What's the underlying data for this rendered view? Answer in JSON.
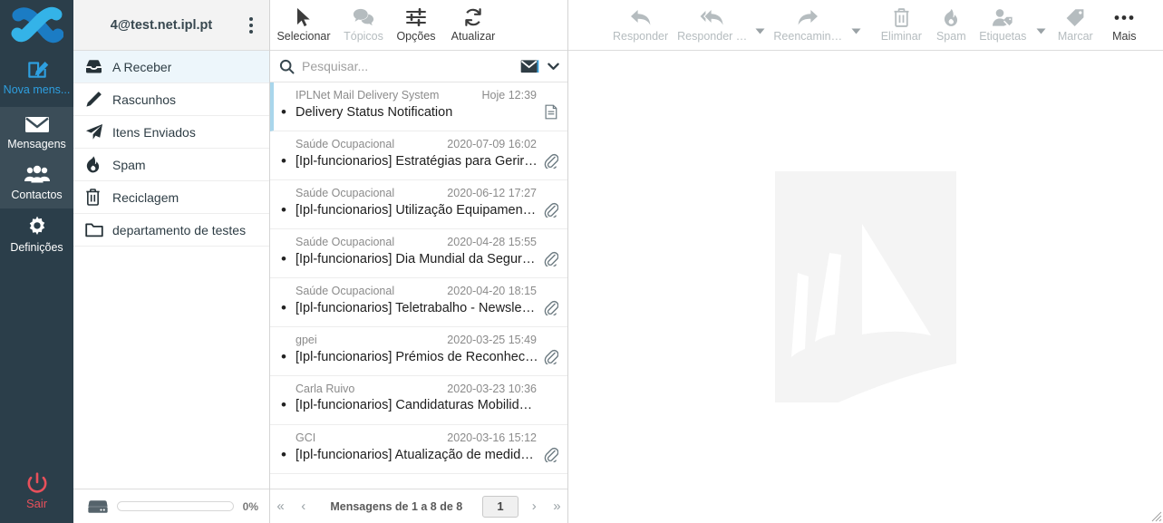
{
  "colors": {
    "rail_bg": "#2b3e4a",
    "rail_group_bg": "#3b4d58",
    "accent_blue": "#2e9fe0",
    "logout_red": "#e8505b",
    "selected_row": "#edf6fb",
    "header_bg": "#f3f3f3"
  },
  "rail": {
    "logo_name": "logo-icon",
    "items": [
      {
        "label": "Nova mens...",
        "icon": "compose-pencil-icon",
        "name": "rail-item-compose"
      },
      {
        "label": "Mensagens",
        "icon": "envelope-icon",
        "name": "rail-item-mensagens"
      },
      {
        "label": "Contactos",
        "icon": "contacts-people-icon",
        "name": "rail-item-contactos"
      },
      {
        "label": "Definições",
        "icon": "gear-icon",
        "name": "rail-item-definicoes"
      }
    ],
    "logout": {
      "label": "Sair",
      "icon": "power-icon"
    }
  },
  "account": {
    "name": "4@test.net.ipl.pt",
    "menu_icon": "kebab-menu-icon"
  },
  "folders": [
    {
      "label": "A Receber",
      "icon": "inbox-icon",
      "active": true
    },
    {
      "label": "Rascunhos",
      "icon": "pencil-icon",
      "active": false
    },
    {
      "label": "Itens Enviados",
      "icon": "paper-plane-icon",
      "active": false
    },
    {
      "label": "Spam",
      "icon": "flame-icon",
      "active": false
    },
    {
      "label": "Reciclagem",
      "icon": "trash-icon",
      "active": false
    },
    {
      "label": "departamento de testes",
      "icon": "folder-icon",
      "active": false
    }
  ],
  "quota": {
    "icon": "hard-drive-icon",
    "percent_label": "0%",
    "percent_value": 0
  },
  "list_toolbar": [
    {
      "label": "Selecionar",
      "icon": "cursor-arrow-icon",
      "disabled": false
    },
    {
      "label": "Tópicos",
      "icon": "speech-bubbles-icon",
      "disabled": true
    },
    {
      "label": "Opções",
      "icon": "sliders-icon",
      "disabled": false
    },
    {
      "label": "Atualizar",
      "icon": "refresh-icon",
      "disabled": false
    }
  ],
  "search": {
    "placeholder": "Pesquisar...",
    "value": "",
    "search_icon": "search-icon",
    "scope_icon": "envelope-filled-icon",
    "dropdown_icon": "chevron-down-icon"
  },
  "messages": [
    {
      "from": "IPLNet Mail Delivery System",
      "date": "Hoje 12:39",
      "subject": "Delivery Status Notification",
      "unread": true,
      "selected": true,
      "badge": "document-icon"
    },
    {
      "from": "Saúde Ocupacional",
      "date": "2020-07-09 16:02",
      "subject": "[Ipl-funcionarios] Estratégias para Gerir a…",
      "unread": true,
      "selected": false,
      "badge": "paperclip-icon"
    },
    {
      "from": "Saúde Ocupacional",
      "date": "2020-06-12 17:27",
      "subject": "[Ipl-funcionarios] Utilização Equipamento…",
      "unread": true,
      "selected": false,
      "badge": "paperclip-icon"
    },
    {
      "from": "Saúde Ocupacional",
      "date": "2020-04-28 15:55",
      "subject": "[Ipl-funcionarios] Dia Mundial da Seguran…",
      "unread": true,
      "selected": false,
      "badge": "paperclip-icon"
    },
    {
      "from": "Saúde Ocupacional",
      "date": "2020-04-20 18:15",
      "subject": "[Ipl-funcionarios] Teletrabalho - Newslett…",
      "unread": true,
      "selected": false,
      "badge": "paperclip-icon"
    },
    {
      "from": "gpei",
      "date": "2020-03-25 15:49",
      "subject": "[Ipl-funcionarios] Prémios de Reconheci…",
      "unread": true,
      "selected": false,
      "badge": "paperclip-icon"
    },
    {
      "from": "Carla Ruivo",
      "date": "2020-03-23 10:36",
      "subject": "[Ipl-funcionarios] Candidaturas Mobilida…",
      "unread": true,
      "selected": false,
      "badge": ""
    },
    {
      "from": "GCI",
      "date": "2020-03-16 15:12",
      "subject": "[Ipl-funcionarios] Atualização de medida…",
      "unread": true,
      "selected": false,
      "badge": "paperclip-icon"
    }
  ],
  "pager": {
    "first_icon": "double-chevron-left-icon",
    "prev_icon": "chevron-left-icon",
    "summary": "Mensagens de 1 a 8 de 8",
    "current_page": "1",
    "next_icon": "chevron-right-icon",
    "last_icon": "double-chevron-right-icon"
  },
  "read_toolbar": [
    {
      "label": "Responder",
      "icon": "reply-icon",
      "disabled": true,
      "caret": false
    },
    {
      "label": "Responder …",
      "icon": "reply-all-icon",
      "disabled": true,
      "caret": true
    },
    {
      "label": "Reencamin…",
      "icon": "forward-icon",
      "disabled": true,
      "caret": true
    },
    {
      "label": "Eliminar",
      "icon": "trash-icon",
      "disabled": true,
      "caret": false
    },
    {
      "label": "Spam",
      "icon": "flame-icon",
      "disabled": true,
      "caret": false
    },
    {
      "label": "Etiquetas",
      "icon": "contact-tag-icon",
      "disabled": true,
      "caret": true
    },
    {
      "label": "Marcar",
      "icon": "tag-icon",
      "disabled": true,
      "caret": false
    },
    {
      "label": "Mais",
      "icon": "ellipsis-icon",
      "disabled": false,
      "caret": false
    }
  ],
  "reading_pane": {
    "watermark_name": "sail-watermark"
  }
}
